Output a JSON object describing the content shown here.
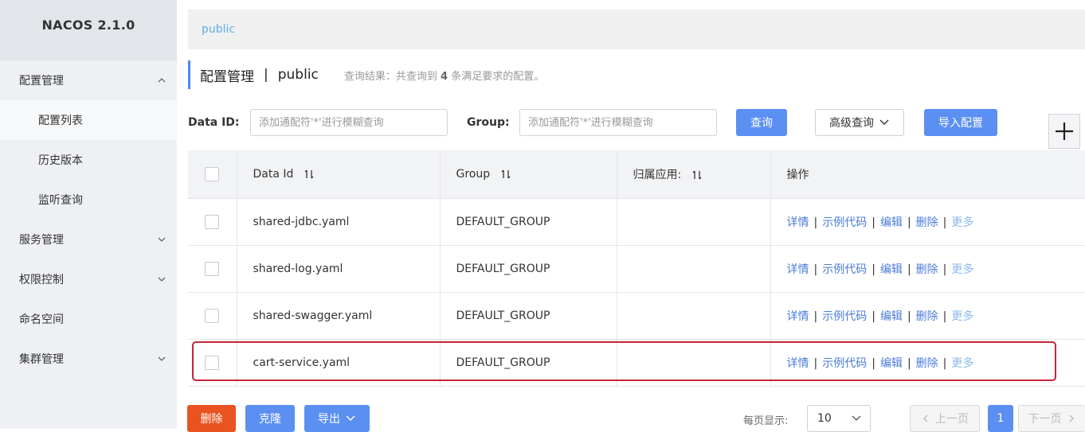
{
  "brand": "NACOS 2.1.0",
  "sidebar": {
    "groups": [
      {
        "label": "配置管理",
        "expanded": true,
        "children": [
          "配置列表",
          "历史版本",
          "监听查询"
        ]
      },
      {
        "label": "服务管理"
      },
      {
        "label": "权限控制"
      },
      {
        "label": "命名空间"
      },
      {
        "label": "集群管理"
      }
    ]
  },
  "tabbar": {
    "namespace": "public"
  },
  "heading": {
    "title": "配置管理",
    "separator": "|",
    "namespace": "public",
    "result_prefix": "查询结果：共查询到",
    "result_count": "4",
    "result_suffix": "条满足要求的配置。"
  },
  "filters": {
    "data_id_label": "Data ID:",
    "data_id_placeholder": "添加通配符'*'进行模糊查询",
    "group_label": "Group:",
    "group_placeholder": "添加通配符'*'进行模糊查询",
    "search_button": "查询",
    "advanced_button": "高级查询",
    "import_button": "导入配置"
  },
  "table": {
    "headers": [
      "Data Id",
      "Group",
      "归属应用:",
      "操作"
    ],
    "rows": [
      {
        "data_id": "shared-jdbc.yaml",
        "group": "DEFAULT_GROUP",
        "app": ""
      },
      {
        "data_id": "shared-log.yaml",
        "group": "DEFAULT_GROUP",
        "app": ""
      },
      {
        "data_id": "shared-swagger.yaml",
        "group": "DEFAULT_GROUP",
        "app": ""
      },
      {
        "data_id": "cart-service.yaml",
        "group": "DEFAULT_GROUP",
        "app": ""
      }
    ],
    "actions": [
      "详情",
      "示例代码",
      "编辑",
      "删除",
      "更多"
    ],
    "action_separator": "|"
  },
  "bottom": {
    "delete_button": "删除",
    "clone_button": "克隆",
    "export_button": "导出",
    "page_size_label": "每页显示:",
    "page_size_value": "10",
    "prev_button": "上一页",
    "current_page": "1",
    "next_button": "下一页"
  },
  "colors": {
    "primary": "#5b8ff2",
    "danger": "#e8531f",
    "link": "#4a7bd8",
    "highlight_border": "#c4253a"
  }
}
